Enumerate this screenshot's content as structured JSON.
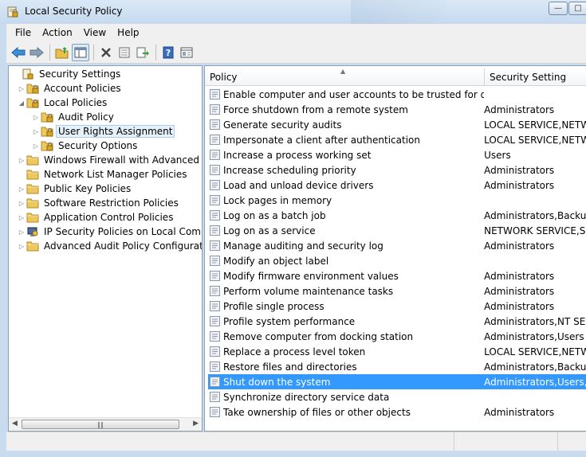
{
  "window": {
    "title": "Local Security Policy"
  },
  "menu": [
    "File",
    "Action",
    "View",
    "Help"
  ],
  "toolbar": {
    "buttons": [
      "back-icon",
      "forward-icon",
      "up-folder-icon",
      "show-hide-tree-icon",
      "delete-icon",
      "properties-icon",
      "export-list-icon",
      "help-icon",
      "console-view-icon"
    ]
  },
  "tree": {
    "items": [
      {
        "label": "Security Settings",
        "arrow": "",
        "icon": "security-settings-icon"
      },
      {
        "label": "Account Policies",
        "arrow": "▷",
        "icon": "folder-icon"
      },
      {
        "label": "Local Policies",
        "arrow": "◢",
        "icon": "folder-icon"
      },
      {
        "label": "Audit Policy",
        "arrow": "▷",
        "icon": "folder-icon"
      },
      {
        "label": "User Rights Assignment",
        "arrow": "▷",
        "icon": "folder-icon"
      },
      {
        "label": "Security Options",
        "arrow": "▷",
        "icon": "folder-icon"
      },
      {
        "label": "Windows Firewall with Advanced Secu",
        "arrow": "▷",
        "icon": "folder-icon"
      },
      {
        "label": "Network List Manager Policies",
        "arrow": "",
        "icon": "folder-icon"
      },
      {
        "label": "Public Key Policies",
        "arrow": "▷",
        "icon": "folder-icon"
      },
      {
        "label": "Software Restriction Policies",
        "arrow": "▷",
        "icon": "folder-icon"
      },
      {
        "label": "Application Control Policies",
        "arrow": "▷",
        "icon": "folder-icon"
      },
      {
        "label": "IP Security Policies on Local Compute",
        "arrow": "▷",
        "icon": "ip-security-icon"
      },
      {
        "label": "Advanced Audit Policy Configuration",
        "arrow": "▷",
        "icon": "folder-icon"
      }
    ],
    "selected_index": 4
  },
  "list": {
    "columns": [
      "Policy",
      "Security Setting"
    ],
    "rows": [
      {
        "policy": "Enable computer and user accounts to be trusted for delega...",
        "setting": ""
      },
      {
        "policy": "Force shutdown from a remote system",
        "setting": "Administrators"
      },
      {
        "policy": "Generate security audits",
        "setting": "LOCAL SERVICE,NETWO"
      },
      {
        "policy": "Impersonate a client after authentication",
        "setting": "LOCAL SERVICE,NETWO"
      },
      {
        "policy": "Increase a process working set",
        "setting": "Users"
      },
      {
        "policy": "Increase scheduling priority",
        "setting": "Administrators"
      },
      {
        "policy": "Load and unload device drivers",
        "setting": "Administrators"
      },
      {
        "policy": "Lock pages in memory",
        "setting": ""
      },
      {
        "policy": "Log on as a batch job",
        "setting": "Administrators,Backup"
      },
      {
        "policy": "Log on as a service",
        "setting": "NETWORK SERVICE,SQ"
      },
      {
        "policy": "Manage auditing and security log",
        "setting": "Administrators"
      },
      {
        "policy": "Modify an object label",
        "setting": ""
      },
      {
        "policy": "Modify firmware environment values",
        "setting": "Administrators"
      },
      {
        "policy": "Perform volume maintenance tasks",
        "setting": "Administrators"
      },
      {
        "policy": "Profile single process",
        "setting": "Administrators"
      },
      {
        "policy": "Profile system performance",
        "setting": "Administrators,NT SERV"
      },
      {
        "policy": "Remove computer from docking station",
        "setting": "Administrators,Users"
      },
      {
        "policy": "Replace a process level token",
        "setting": "LOCAL SERVICE,NETWO"
      },
      {
        "policy": "Restore files and directories",
        "setting": "Administrators,Backup"
      },
      {
        "policy": "Shut down the system",
        "setting": "Administrators,Users,Ba"
      },
      {
        "policy": "Synchronize directory service data",
        "setting": ""
      },
      {
        "policy": "Take ownership of files or other objects",
        "setting": "Administrators"
      }
    ],
    "selected_index": 19
  },
  "colors": {
    "selection": "#3399ff",
    "frame": "#c9dcef",
    "tree_selection": "#e5f1fb"
  }
}
